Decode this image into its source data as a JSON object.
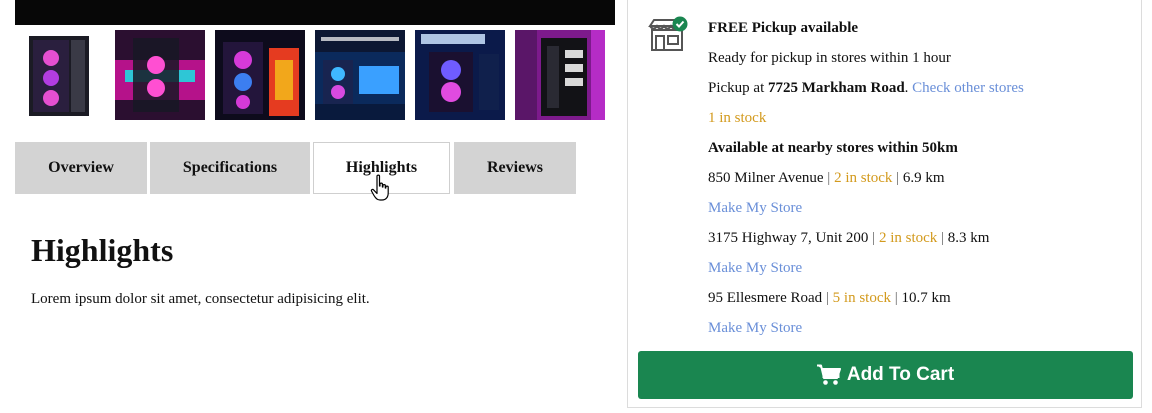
{
  "gallery": {
    "thumbnails": [
      {
        "icon": "pc-case-pink-glow-image"
      },
      {
        "icon": "pc-case-brand-splash-image"
      },
      {
        "icon": "pc-case-dragon-art-image"
      },
      {
        "icon": "pc-case-dazzle-desk-image"
      },
      {
        "icon": "pc-case-stgaubron-banner-image"
      },
      {
        "icon": "pc-case-ports-spec-image"
      }
    ]
  },
  "tabs": [
    {
      "label": "Overview"
    },
    {
      "label": "Specifications"
    },
    {
      "label": "Highlights",
      "active": true
    },
    {
      "label": "Reviews"
    }
  ],
  "content": {
    "title": "Highlights",
    "body": "Lorem ipsum dolor sit amet, consectetur adipisicing elit."
  },
  "pickup": {
    "icon": "store-check-icon",
    "heading": "FREE Pickup available",
    "ready": "Ready for pickup in stores within 1 hour",
    "pickup_prefix": "Pickup at ",
    "store_name": "7725 Markham Road",
    "store_suffix": ".",
    "check_link": "Check other stores",
    "stock": "1 in stock",
    "nearby_heading": "Available at nearby stores within 50km",
    "nearby": [
      {
        "address": "850 Milner Avenue",
        "stock": "2 in stock",
        "distance": "6.9 km",
        "link": "Make My Store"
      },
      {
        "address": "3175 Highway 7, Unit 200",
        "stock": "2 in stock",
        "distance": "8.3 km",
        "link": "Make My Store"
      },
      {
        "address": "95 Ellesmere Road",
        "stock": "5 in stock",
        "distance": "10.7 km",
        "link": "Make My Store"
      }
    ],
    "separator": "|"
  },
  "cart": {
    "label": "Add To Cart",
    "icon": "cart-icon"
  },
  "colors": {
    "link": "#6a8fd8",
    "stock": "#d39a1d",
    "cart": "#1a8650",
    "tab_bg": "#d3d3d3"
  }
}
